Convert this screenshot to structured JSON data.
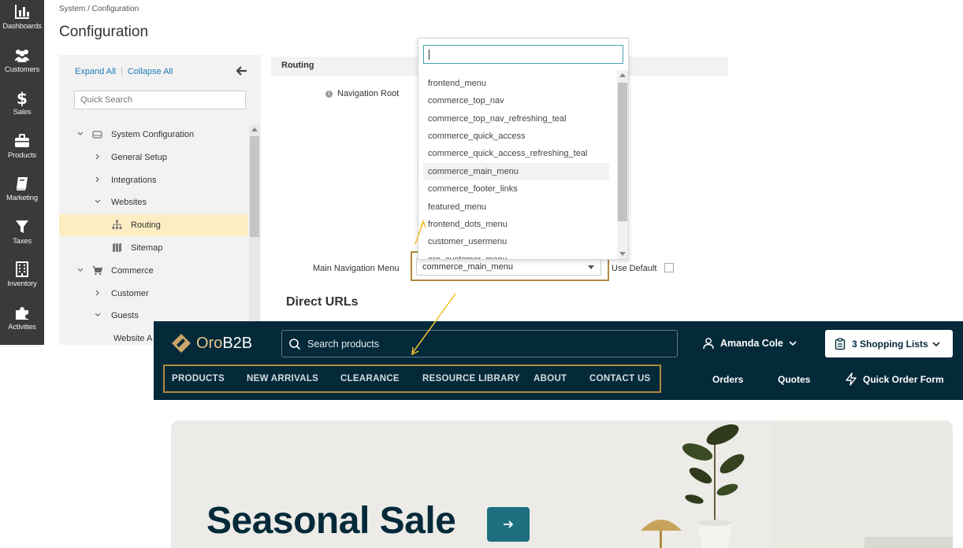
{
  "admin_sidebar": {
    "items": [
      {
        "label": "Dashboards",
        "icon": "bar-chart-icon"
      },
      {
        "label": "Customers",
        "icon": "users-icon"
      },
      {
        "label": "Sales",
        "icon": "dollar-icon"
      },
      {
        "label": "Products",
        "icon": "briefcase-icon"
      },
      {
        "label": "Marketing",
        "icon": "book-icon"
      },
      {
        "label": "Taxes",
        "icon": "filter-icon"
      },
      {
        "label": "Inventory",
        "icon": "building-icon"
      },
      {
        "label": "Activities",
        "icon": "puzzle-icon"
      }
    ]
  },
  "header": {
    "breadcrumb": "System / Configuration",
    "title": "Configuration"
  },
  "tree": {
    "expand_all": "Expand All",
    "collapse_all": "Collapse All",
    "search_placeholder": "Quick Search",
    "items": [
      {
        "label": "System Configuration",
        "level": 0,
        "state": "expanded",
        "icon": "drive-icon"
      },
      {
        "label": "General Setup",
        "level": 1,
        "state": "collapsed"
      },
      {
        "label": "Integrations",
        "level": 1,
        "state": "collapsed"
      },
      {
        "label": "Websites",
        "level": 1,
        "state": "expanded"
      },
      {
        "label": "Routing",
        "level": 2,
        "state": "leaf",
        "icon": "sitemap-icon",
        "active": true
      },
      {
        "label": "Sitemap",
        "level": 2,
        "state": "leaf",
        "icon": "map-icon"
      },
      {
        "label": "Commerce",
        "level": 0,
        "state": "expanded",
        "icon": "cart-icon"
      },
      {
        "label": "Customer",
        "level": 1,
        "state": "collapsed"
      },
      {
        "label": "Guests",
        "level": 1,
        "state": "expanded"
      },
      {
        "label": "Website A",
        "level": 2,
        "state": "leaf"
      }
    ]
  },
  "routing": {
    "section_title": "Routing",
    "navigation_root_label": "Navigation Root",
    "main_nav_label": "Main Navigation Menu",
    "main_nav_value": "commerce_main_menu",
    "use_default_label": "Use Default",
    "direct_urls_title": "Direct URLs"
  },
  "dropdown": {
    "options": [
      "frontend_menu",
      "commerce_top_nav",
      "commerce_top_nav_refreshing_teal",
      "commerce_quick_access",
      "commerce_quick_access_refreshing_teal",
      "commerce_main_menu",
      "commerce_footer_links",
      "featured_menu",
      "frontend_dots_menu",
      "customer_usermenu",
      "oro_customer_menu"
    ],
    "highlighted": "commerce_main_menu"
  },
  "storefront": {
    "logo_oro": "Oro",
    "logo_b2b": "B2B",
    "search_placeholder": "Search products",
    "user_name": "Amanda Cole",
    "shopping_lists": "3 Shopping Lists",
    "menu": [
      "PRODUCTS",
      "NEW ARRIVALS",
      "CLEARANCE",
      "RESOURCE LIBRARY",
      "ABOUT",
      "CONTACT US"
    ],
    "right_links": [
      "Orders",
      "Quotes",
      "Quick Order Form"
    ]
  },
  "hero": {
    "title": "Seasonal Sale"
  },
  "colors": {
    "admin_sidebar": "#3a3a3a",
    "storefront_bg": "#042a3a",
    "highlight_border": "#b08a3c",
    "active_row": "#fcedc3",
    "hero_button": "#1d6f80",
    "arrow": "#f0c030"
  }
}
